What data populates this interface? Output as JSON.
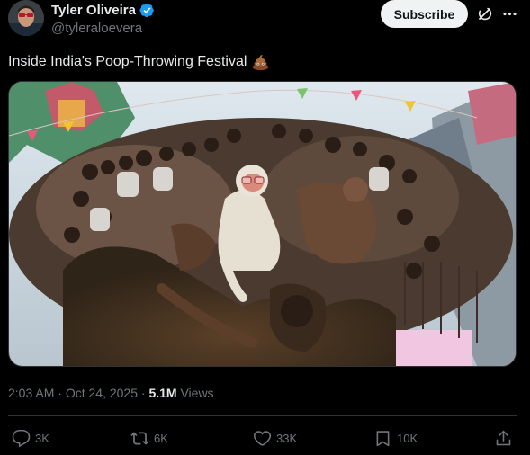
{
  "author": {
    "name": "Tyler Oliveira",
    "handle": "@tyleraloevera",
    "verified": true
  },
  "header": {
    "subscribe_label": "Subscribe",
    "grok_icon": "grok-icon",
    "more_icon": "more-icon"
  },
  "post": {
    "text": "Inside India's Poop-Throwing Festival",
    "emoji": "poop-emoji"
  },
  "meta": {
    "time": "2:03 AM",
    "separator": "·",
    "date": "Oct 24, 2025",
    "views_count": "5.1M",
    "views_label": "Views"
  },
  "actions": {
    "replies": "3K",
    "reposts": "6K",
    "likes": "33K",
    "bookmarks": "10K"
  },
  "colors": {
    "background": "#000000",
    "text_primary": "#e7e9ea",
    "text_secondary": "#71767b",
    "verified_blue": "#1d9bf0",
    "subscribe_bg": "#eff3f4",
    "divider": "#2f3336"
  }
}
